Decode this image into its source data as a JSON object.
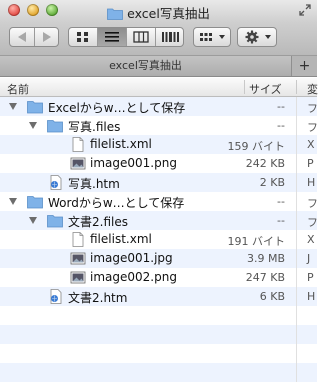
{
  "window": {
    "title": "excel写真抽出"
  },
  "tab": {
    "label": "excel写真抽出",
    "new_tab_symbol": "+"
  },
  "columns": {
    "name": "名前",
    "size": "サイズ",
    "kind": "変"
  },
  "rows": [
    {
      "name": "Excelからw…として保存",
      "size": "--",
      "kind": "フ",
      "icon": "folder-icon",
      "expanded": true
    },
    {
      "name": "写真.files",
      "size": "--",
      "kind": "フ",
      "icon": "folder-icon",
      "expanded": true
    },
    {
      "name": "filelist.xml",
      "size": "159 バイト",
      "kind": "X",
      "icon": "document-icon"
    },
    {
      "name": "image001.png",
      "size": "242 KB",
      "kind": "P",
      "icon": "image-icon"
    },
    {
      "name": "写真.htm",
      "size": "2 KB",
      "kind": "H",
      "icon": "html-file-icon"
    },
    {
      "name": "Wordからw…として保存",
      "size": "--",
      "kind": "フ",
      "icon": "folder-icon",
      "expanded": true
    },
    {
      "name": "文書2.files",
      "size": "--",
      "kind": "フ",
      "icon": "folder-icon",
      "expanded": true
    },
    {
      "name": "filelist.xml",
      "size": "191 バイト",
      "kind": "X",
      "icon": "document-icon"
    },
    {
      "name": "image001.jpg",
      "size": "3.9 MB",
      "kind": "J",
      "icon": "image-icon"
    },
    {
      "name": "image002.png",
      "size": "247 KB",
      "kind": "P",
      "icon": "image-icon"
    },
    {
      "name": "文書2.htm",
      "size": "6 KB",
      "kind": "H",
      "icon": "html-file-icon"
    }
  ],
  "colors": {
    "stripe": "#edf3fe",
    "folder": "#7fb2e8"
  }
}
